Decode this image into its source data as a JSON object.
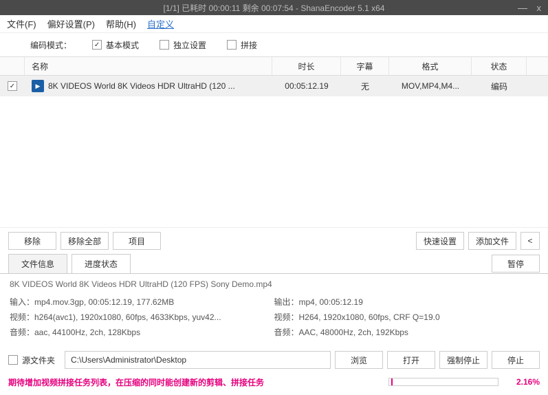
{
  "titlebar": {
    "text": "[1/1] 已耗时 00:00:11 剩余 00:07:54 - ShanaEncoder 5.1 x64"
  },
  "menu": {
    "file": "文件(F)",
    "pref": "偏好设置(P)",
    "help": "帮助(H)",
    "custom": "自定义"
  },
  "mode": {
    "label": "编码模式：",
    "basic": "基本模式",
    "indep": "独立设置",
    "concat": "拼接"
  },
  "headers": {
    "name": "名称",
    "duration": "时长",
    "subtitle": "字幕",
    "format": "格式",
    "status": "状态"
  },
  "row": {
    "name": "8K VIDEOS   World 8K Videos HDR UltraHD  (120 ...",
    "duration": "00:05:12.19",
    "subtitle": "无",
    "format": "MOV,MP4,M4...",
    "status": "编码"
  },
  "buttons": {
    "remove": "移除",
    "removeAll": "移除全部",
    "project": "项目",
    "quick": "快速设置",
    "addFile": "添加文件",
    "lt": "<",
    "pause": "暂停",
    "browse": "浏览",
    "open": "打开",
    "forceStop": "强制停止",
    "stop": "停止"
  },
  "tabs": {
    "fileinfo": "文件信息",
    "progress": "进度状态"
  },
  "info": {
    "fname": "8K VIDEOS   World 8K Videos HDR UltraHD  (120 FPS)   Sony Demo.mp4",
    "in1": "输入：mp4.mov.3gp, 00:05:12.19, 177.62MB",
    "in2": "视频：h264(avc1), 1920x1080, 60fps, 4633Kbps, yuv42...",
    "in3": "音频：aac, 44100Hz, 2ch, 128Kbps",
    "out1": "输出：mp4, 00:05:12.19",
    "out2": "视频：H264, 1920x1080, 60fps, CRF Q=19.0",
    "out3": "音频：AAC, 48000Hz, 2ch, 192Kbps"
  },
  "field": {
    "label": "源文件夹",
    "value": "C:\\Users\\Administrator\\Desktop"
  },
  "status": {
    "msg": "期待增加视频拼接任务列表，在压缩的同时能创建新的剪辑、拼接任务",
    "pct": "2.16%"
  }
}
